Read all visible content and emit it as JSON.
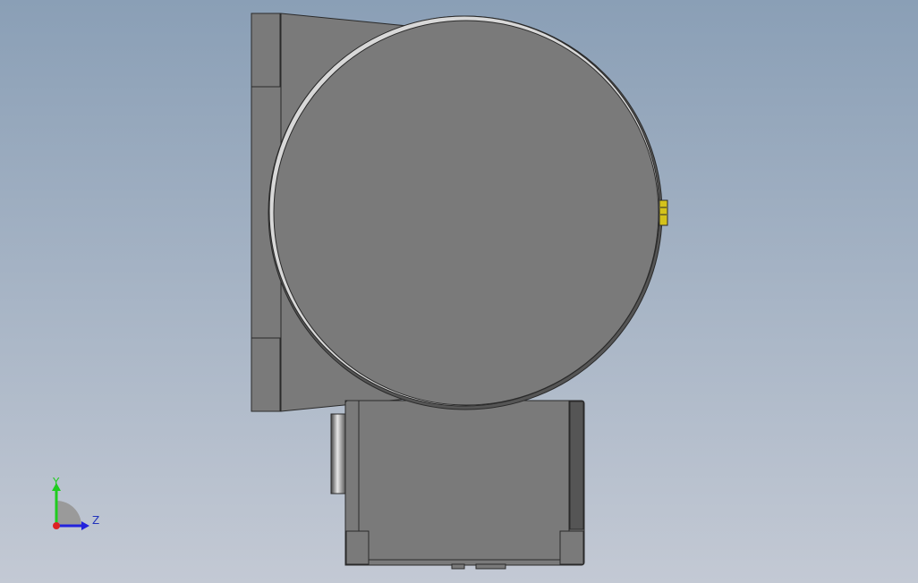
{
  "viewport": {
    "background_top": "#8a9fb6",
    "background_bottom": "#c3c9d4"
  },
  "model": {
    "body_color": "#7a7a7a",
    "edge_color": "#2a2a2a",
    "rim_color": "#d8d8d8",
    "shadow_color": "#555555",
    "connector_color": "#d4c21a"
  },
  "triad": {
    "y_label": "Y",
    "z_label": "Z",
    "y_color": "#1fcc1f",
    "z_color": "#2222dd",
    "x_color": "#dd2222",
    "label_color": "#2233bb",
    "quadrant_color": "#9a9a9a"
  }
}
